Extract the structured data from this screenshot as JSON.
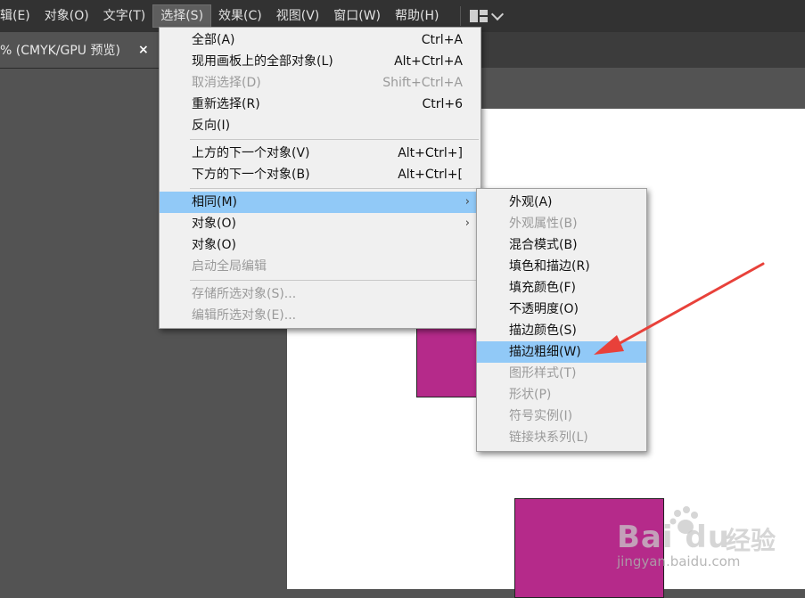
{
  "menubar": {
    "items": [
      "辑(E)",
      "对象(O)",
      "文字(T)",
      "选择(S)",
      "效果(C)",
      "视图(V)",
      "窗口(W)",
      "帮助(H)"
    ]
  },
  "document_tab": {
    "title": "% (CMYK/GPU 预览)",
    "close": "×"
  },
  "select_menu": {
    "items": [
      {
        "label": "全部(A)",
        "shortcut": "Ctrl+A"
      },
      {
        "label": "现用画板上的全部对象(L)",
        "shortcut": "Alt+Ctrl+A"
      },
      {
        "label": "取消选择(D)",
        "shortcut": "Shift+Ctrl+A"
      },
      {
        "label": "重新选择(R)",
        "shortcut": "Ctrl+6"
      },
      {
        "label": "反向(I)"
      },
      {
        "label": "上方的下一个对象(V)",
        "shortcut": "Alt+Ctrl+]"
      },
      {
        "label": "下方的下一个对象(B)",
        "shortcut": "Alt+Ctrl+["
      },
      {
        "label": "相同(M)",
        "arrow": "›"
      },
      {
        "label": "对象(O)",
        "arrow": "›"
      },
      {
        "label": "对象(O)"
      },
      {
        "label": "启动全局编辑"
      },
      {
        "label": "存储所选对象(S)..."
      },
      {
        "label": "编辑所选对象(E)..."
      }
    ]
  },
  "same_submenu": {
    "items": [
      {
        "label": "外观(A)"
      },
      {
        "label": "外观属性(B)"
      },
      {
        "label": "混合模式(B)"
      },
      {
        "label": "填色和描边(R)"
      },
      {
        "label": "填充颜色(F)"
      },
      {
        "label": "不透明度(O)"
      },
      {
        "label": "描边颜色(S)"
      },
      {
        "label": "描边粗细(W)"
      },
      {
        "label": "图形样式(T)"
      },
      {
        "label": "形状(P)"
      },
      {
        "label": "符号实例(I)"
      },
      {
        "label": "链接块系列(L)"
      }
    ]
  },
  "colors": {
    "shape_fill": "#b52a8a",
    "highlight": "#91c9f7",
    "annotation_arrow": "#e8413a"
  },
  "watermark": {
    "brand": "Bai du",
    "product": "经验",
    "url": "jingyan.baidu.com"
  }
}
